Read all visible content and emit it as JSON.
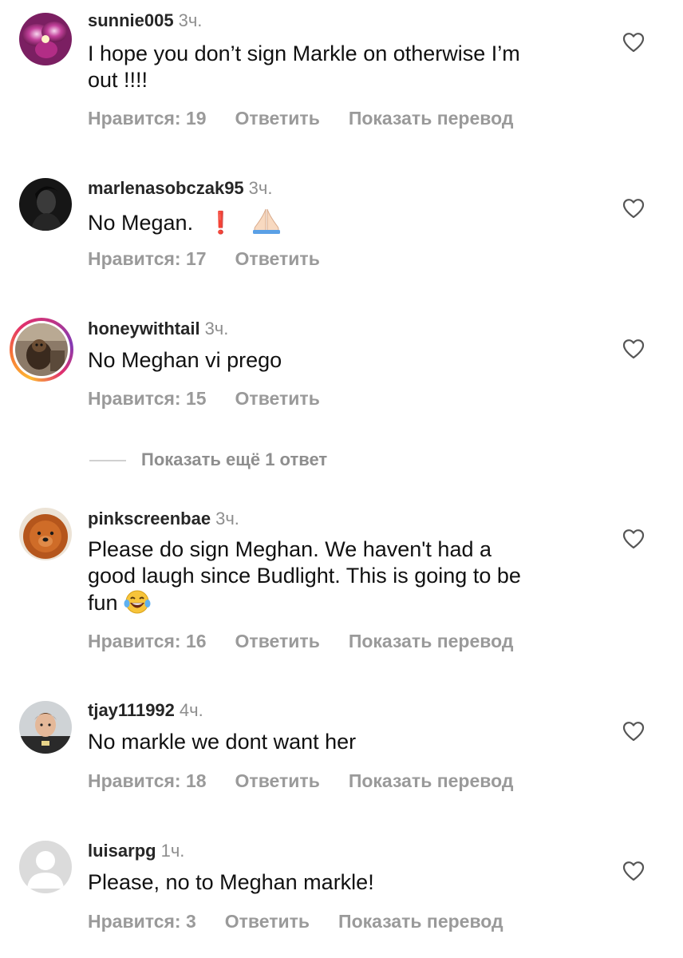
{
  "actions": {
    "like_prefix": "Нравится:",
    "reply": "Ответить",
    "translate": "Показать перевод"
  },
  "more_replies": "Показать ещё 1 ответ",
  "comments": [
    {
      "username": "sunnie005",
      "time": "3ч.",
      "text_line1": "I hope you don’t sign Markle on otherwise I’m",
      "text_line2": "out !!!!",
      "likes": "19",
      "avatar_icon": "orchid-avatar"
    },
    {
      "username": "marlenasobczak95",
      "time": "3ч.",
      "text": "No Megan.",
      "emoji_exclamation": "❗",
      "emoji_hands": "folded-hands-icon",
      "likes": "17",
      "avatar_icon": "dark-portrait-avatar"
    },
    {
      "username": "honeywithtail",
      "time": "3ч.",
      "text": "No Meghan vi prego",
      "likes": "15",
      "avatar_icon": "dog-photo-avatar"
    },
    {
      "username": "pinkscreenbae",
      "time": "3ч.",
      "text_line1": "Please do sign Meghan. We haven't had a",
      "text_line2": "good laugh since Budlight. This is going to be",
      "text_line3": "fun",
      "emoji_laugh": "laughing-crying-icon",
      "likes": "16",
      "avatar_icon": "chow-chow-avatar"
    },
    {
      "username": "tjay111992",
      "time": "4ч.",
      "text": "No markle we dont want her",
      "likes": "18",
      "avatar_icon": "child-photo-avatar"
    },
    {
      "username": "luisarpg",
      "time": "1ч.",
      "text": "Please, no to Meghan markle!",
      "likes": "3",
      "avatar_icon": "default-user-avatar"
    }
  ],
  "colors": {
    "text": "#111111",
    "meta": "#8e8e8e",
    "action": "#9a9a9a",
    "exclamation": "#d8141b"
  }
}
